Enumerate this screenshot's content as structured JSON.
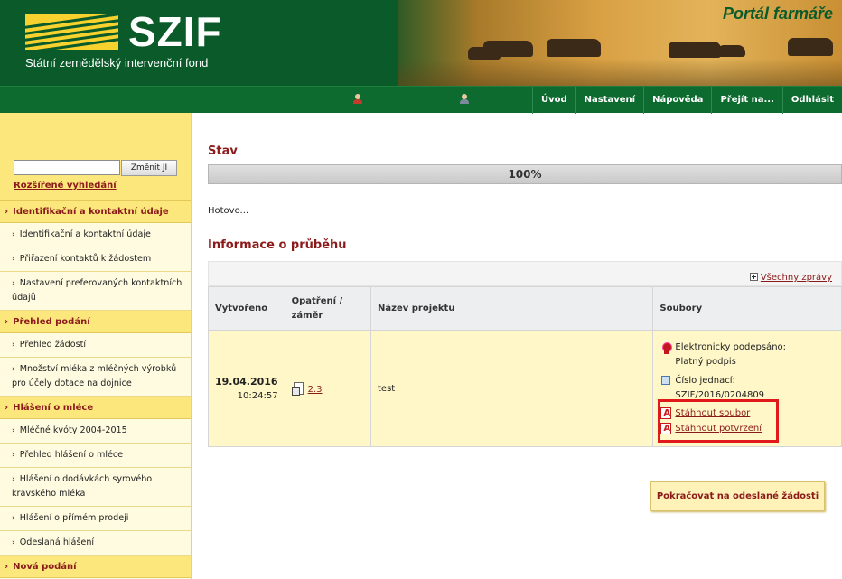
{
  "header": {
    "logo_text": "SZIF",
    "logo_subtitle": "Státní zemědělský intervenční fond",
    "portal_title": "Portál farmáře"
  },
  "nav": {
    "items": [
      "Úvod",
      "Nastavení",
      "Nápověda",
      "Přejít na...",
      "Odhlásit"
    ]
  },
  "sidebar": {
    "search": {
      "value": "",
      "button": "Změnit JI"
    },
    "advanced_link": "Rozšířené vyhledání",
    "sections": [
      {
        "title": "Identifikační a kontaktní údaje",
        "items": [
          "Identifikační a kontaktní údaje",
          "Přiřazení kontaktů k žádostem",
          "Nastavení preferovaných kontaktních údajů"
        ]
      },
      {
        "title": "Přehled podání",
        "items": [
          "Přehled žádostí",
          "Množství mléka z mléčných výrobků pro účely dotace na dojnice"
        ]
      },
      {
        "title": "Hlášení o mléce",
        "items": [
          "Mléčné kvóty 2004-2015",
          "Přehled hlášení o mléce",
          "Hlášení o dodávkách syrového kravského mléka",
          "Hlášení o přímém prodeji",
          "Odeslaná hlášení"
        ]
      },
      {
        "title": "Nová podání",
        "items": []
      }
    ]
  },
  "main": {
    "status_title": "Stav",
    "progress": {
      "label": "100%",
      "value": 100
    },
    "status_text": "Hotovo...",
    "info_title": "Informace o průběhu",
    "all_messages": "Všechny zprávy",
    "table": {
      "headers": [
        "Vytvořeno",
        "Opatření / záměr",
        "Název projektu",
        "Soubory"
      ],
      "row": {
        "date": "19.04.2016",
        "time": "10:24:57",
        "measure": "2.3",
        "project": "test",
        "signed_label": "Elektronicky podepsáno:",
        "signed_value": "Platný podpis",
        "ref_label": "Číslo jednací:",
        "ref_value": "SZIF/2016/0204809",
        "download_file": "Stáhnout soubor",
        "download_confirmation": "Stáhnout potvrzení"
      }
    },
    "continue_button": "Pokračovat na odeslané žádosti"
  }
}
